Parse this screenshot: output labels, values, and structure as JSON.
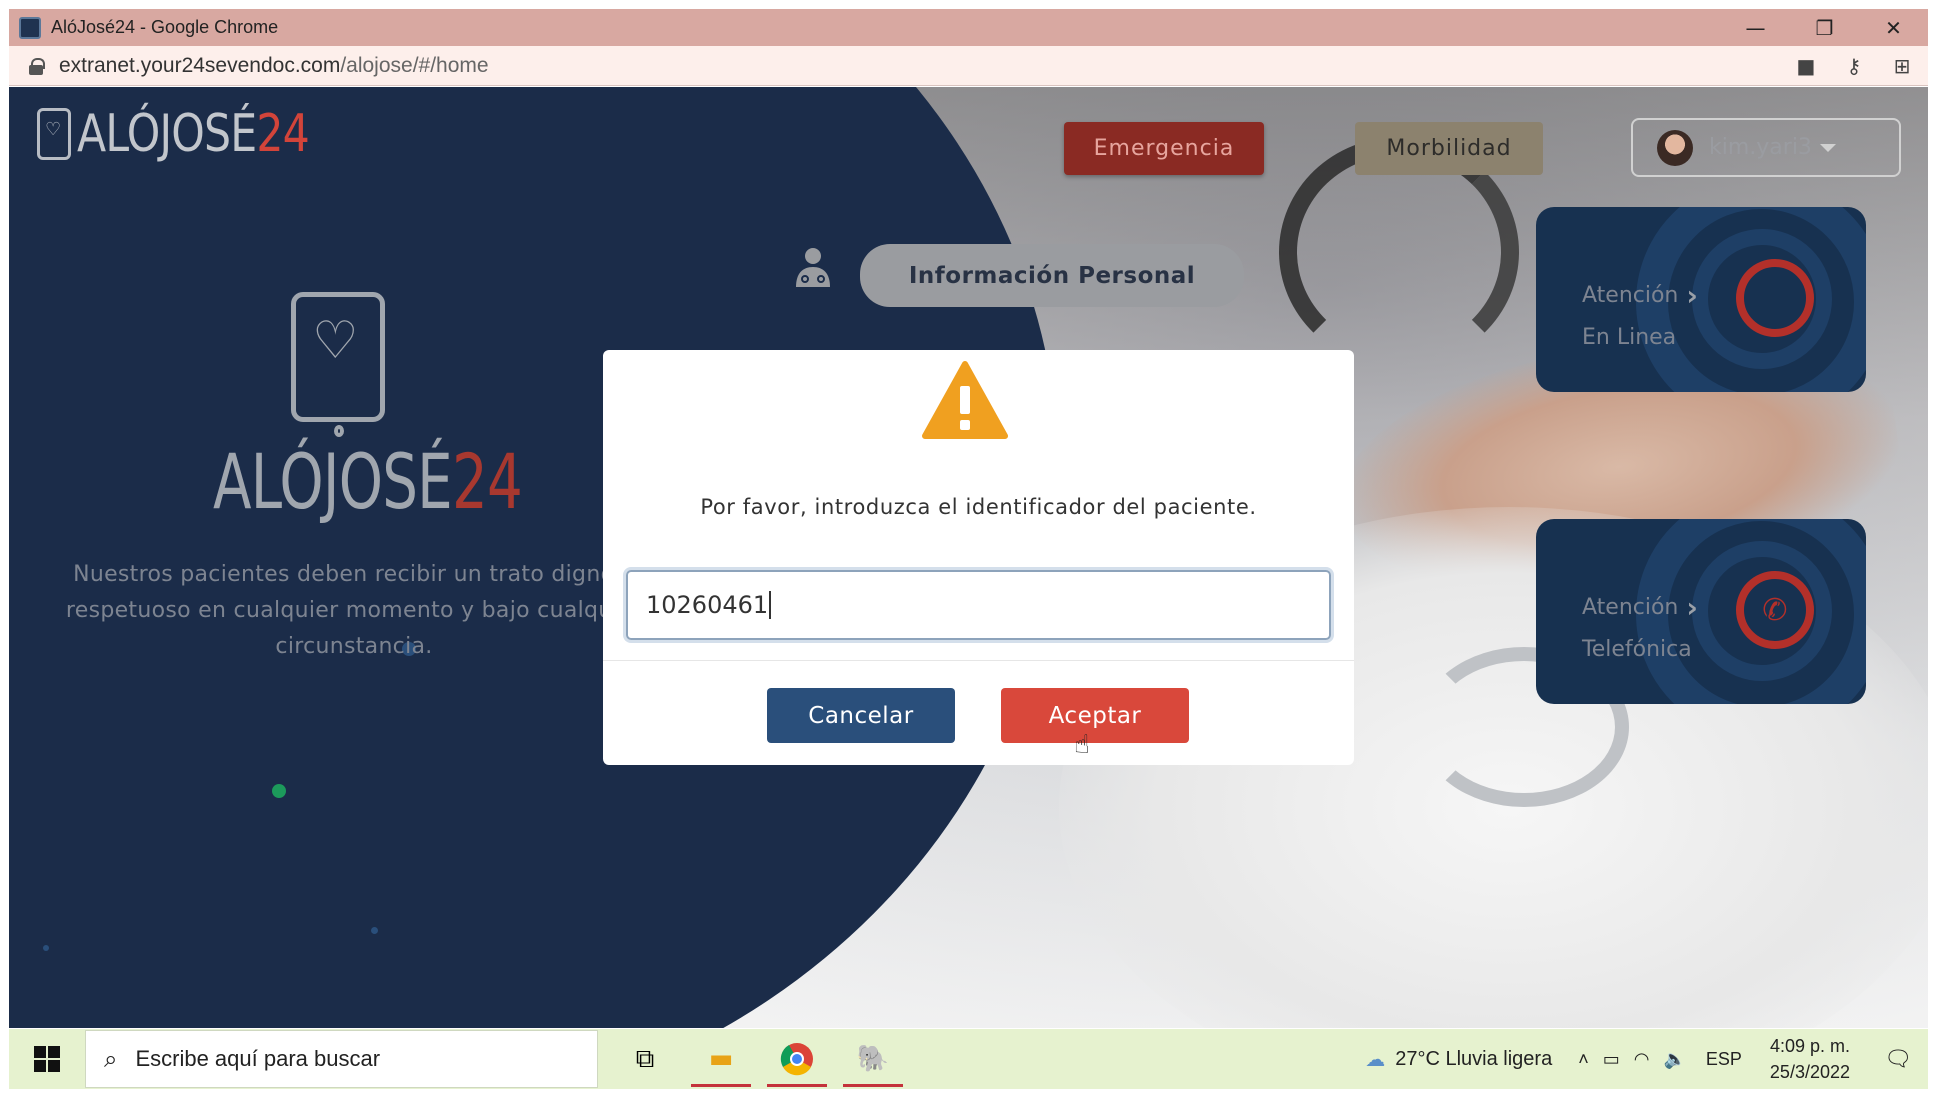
{
  "window": {
    "title": "AlóJosé24 - Google Chrome",
    "controls": {
      "minimize": "—",
      "restore": "❐",
      "close": "✕"
    }
  },
  "address_bar": {
    "url_host": "extranet.your24sevendoc.com",
    "url_path": "/alojose/#/home",
    "icons": [
      "camera-icon",
      "key-icon",
      "translate-icon"
    ]
  },
  "header": {
    "logo": {
      "word": "ALÓJOSÉ",
      "num": "24"
    },
    "emergencia_label": "Emergencia",
    "morbilidad_label": "Morbilidad",
    "username": "kim.yari3"
  },
  "info_personal": {
    "label": "Información Personal"
  },
  "brand": {
    "logo": {
      "word": "ALÓJOSÉ",
      "num": "24"
    },
    "tagline": "Nuestros pacientes deben recibir un trato digno y respetuoso en cualquier momento y bajo cualquier circunstancia."
  },
  "cards": [
    {
      "line1": "Atención",
      "line2": "En Linea",
      "icon": "online-target-icon"
    },
    {
      "line1": "Atención",
      "line2": "Telefónica",
      "icon": "phone-icon"
    }
  ],
  "dialog": {
    "icon": "warning-icon",
    "message": "Por favor, introduzca el identificador del paciente.",
    "input_value": "10260461",
    "cancel_label": "Cancelar",
    "accept_label": "Aceptar"
  },
  "taskbar": {
    "search_placeholder": "Escribe aquí para buscar",
    "weather": "27°C  Lluvia ligera",
    "language": "ESP",
    "time": "4:09 p. m.",
    "date": "25/3/2022"
  },
  "colors": {
    "navy": "#1b2c49",
    "emergency": "#8a2a23",
    "accept": "#d9483b",
    "cancel": "#2a4f7b",
    "warning": "#f0a020"
  }
}
